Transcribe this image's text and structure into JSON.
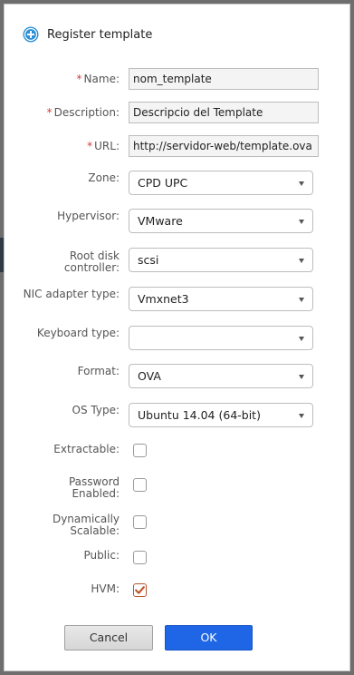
{
  "dialog": {
    "title": "Register template",
    "icon": "plus-circle-icon"
  },
  "fields": {
    "name": {
      "label": "Name:",
      "required_mark": "*",
      "value": "nom_template"
    },
    "description": {
      "label": "Description:",
      "required_mark": "*",
      "value": "Descripcio del Template"
    },
    "url": {
      "label": "URL:",
      "required_mark": "*",
      "value": "http://servidor-web/template.ova"
    },
    "zone": {
      "label": "Zone:",
      "value": "CPD UPC"
    },
    "hypervisor": {
      "label": "Hypervisor:",
      "value": "VMware"
    },
    "root_disk_controller": {
      "label_line1": "Root disk",
      "label_line2": "controller:",
      "value": "scsi"
    },
    "nic_adapter_type": {
      "label": "NIC adapter type:",
      "value": "Vmxnet3"
    },
    "keyboard_type": {
      "label": "Keyboard type:",
      "value": ""
    },
    "format": {
      "label": "Format:",
      "value": "OVA"
    },
    "os_type": {
      "label": "OS Type:",
      "value": "Ubuntu 14.04 (64-bit)"
    }
  },
  "checkboxes": {
    "extractable": {
      "label": "Extractable:",
      "checked": false
    },
    "password_enabled": {
      "label_line1": "Password",
      "label_line2": "Enabled:",
      "checked": false
    },
    "dynamically_scalable": {
      "label_line1": "Dynamically",
      "label_line2": "Scalable:",
      "checked": false
    },
    "public": {
      "label": "Public:",
      "checked": false
    },
    "hvm": {
      "label": "HVM:",
      "checked": true
    }
  },
  "buttons": {
    "cancel": "Cancel",
    "ok": "OK"
  },
  "colors": {
    "accent": "#1f66e6",
    "required": "#d23b3b",
    "check_mark": "#c0562b",
    "header_icon": "#2a8fd6"
  }
}
